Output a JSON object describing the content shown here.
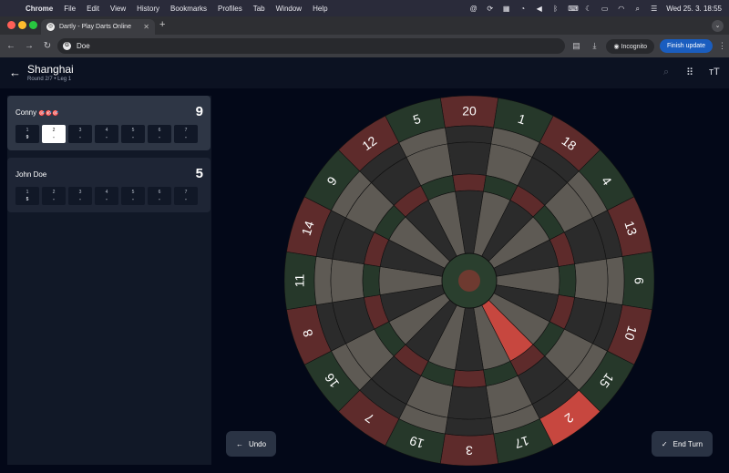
{
  "menubar": {
    "app": "Chrome",
    "items": [
      "File",
      "Edit",
      "View",
      "History",
      "Bookmarks",
      "Profiles",
      "Tab",
      "Window",
      "Help"
    ],
    "clock": "Wed 25. 3.  18:55"
  },
  "browser": {
    "tab_title": "Dartly - Play Darts Online",
    "address": "Doe",
    "incognito_label": "Incognito",
    "finish_update_label": "Finish update"
  },
  "app": {
    "title": "Shanghai",
    "subtitle": "Round 2/7 • Leg 1",
    "players": [
      {
        "name": "Conny",
        "darts_marker": "🎯🎯🎯",
        "score": "9",
        "rounds": [
          {
            "num": "1",
            "val": "9"
          },
          {
            "num": "2",
            "val": "-"
          },
          {
            "num": "3",
            "val": "-"
          },
          {
            "num": "4",
            "val": "-"
          },
          {
            "num": "5",
            "val": "-"
          },
          {
            "num": "6",
            "val": "-"
          },
          {
            "num": "7",
            "val": "-"
          }
        ]
      },
      {
        "name": "John Doe",
        "score": "5",
        "rounds": [
          {
            "num": "1",
            "val": "5"
          },
          {
            "num": "2",
            "val": "-"
          },
          {
            "num": "3",
            "val": "-"
          },
          {
            "num": "4",
            "val": "-"
          },
          {
            "num": "5",
            "val": "-"
          },
          {
            "num": "6",
            "val": "-"
          },
          {
            "num": "7",
            "val": "-"
          }
        ]
      }
    ],
    "undo_label": "Undo",
    "end_turn_label": "End Turn"
  },
  "dartboard": {
    "numbers": [
      20,
      1,
      18,
      4,
      13,
      6,
      10,
      15,
      2,
      17,
      3,
      19,
      7,
      16,
      8,
      11,
      14,
      9,
      12,
      5
    ],
    "highlight_sector": 2,
    "colors": {
      "dark": "#2b2b2b",
      "light": "#5e5a54",
      "ring_red": "#5e2b2b",
      "ring_green": "#26382a",
      "highlight_red": "#c7473f",
      "bull_red": "#6e3a30",
      "bull_green": "#2a3f2e",
      "number_ring": "#0c0f14"
    }
  }
}
